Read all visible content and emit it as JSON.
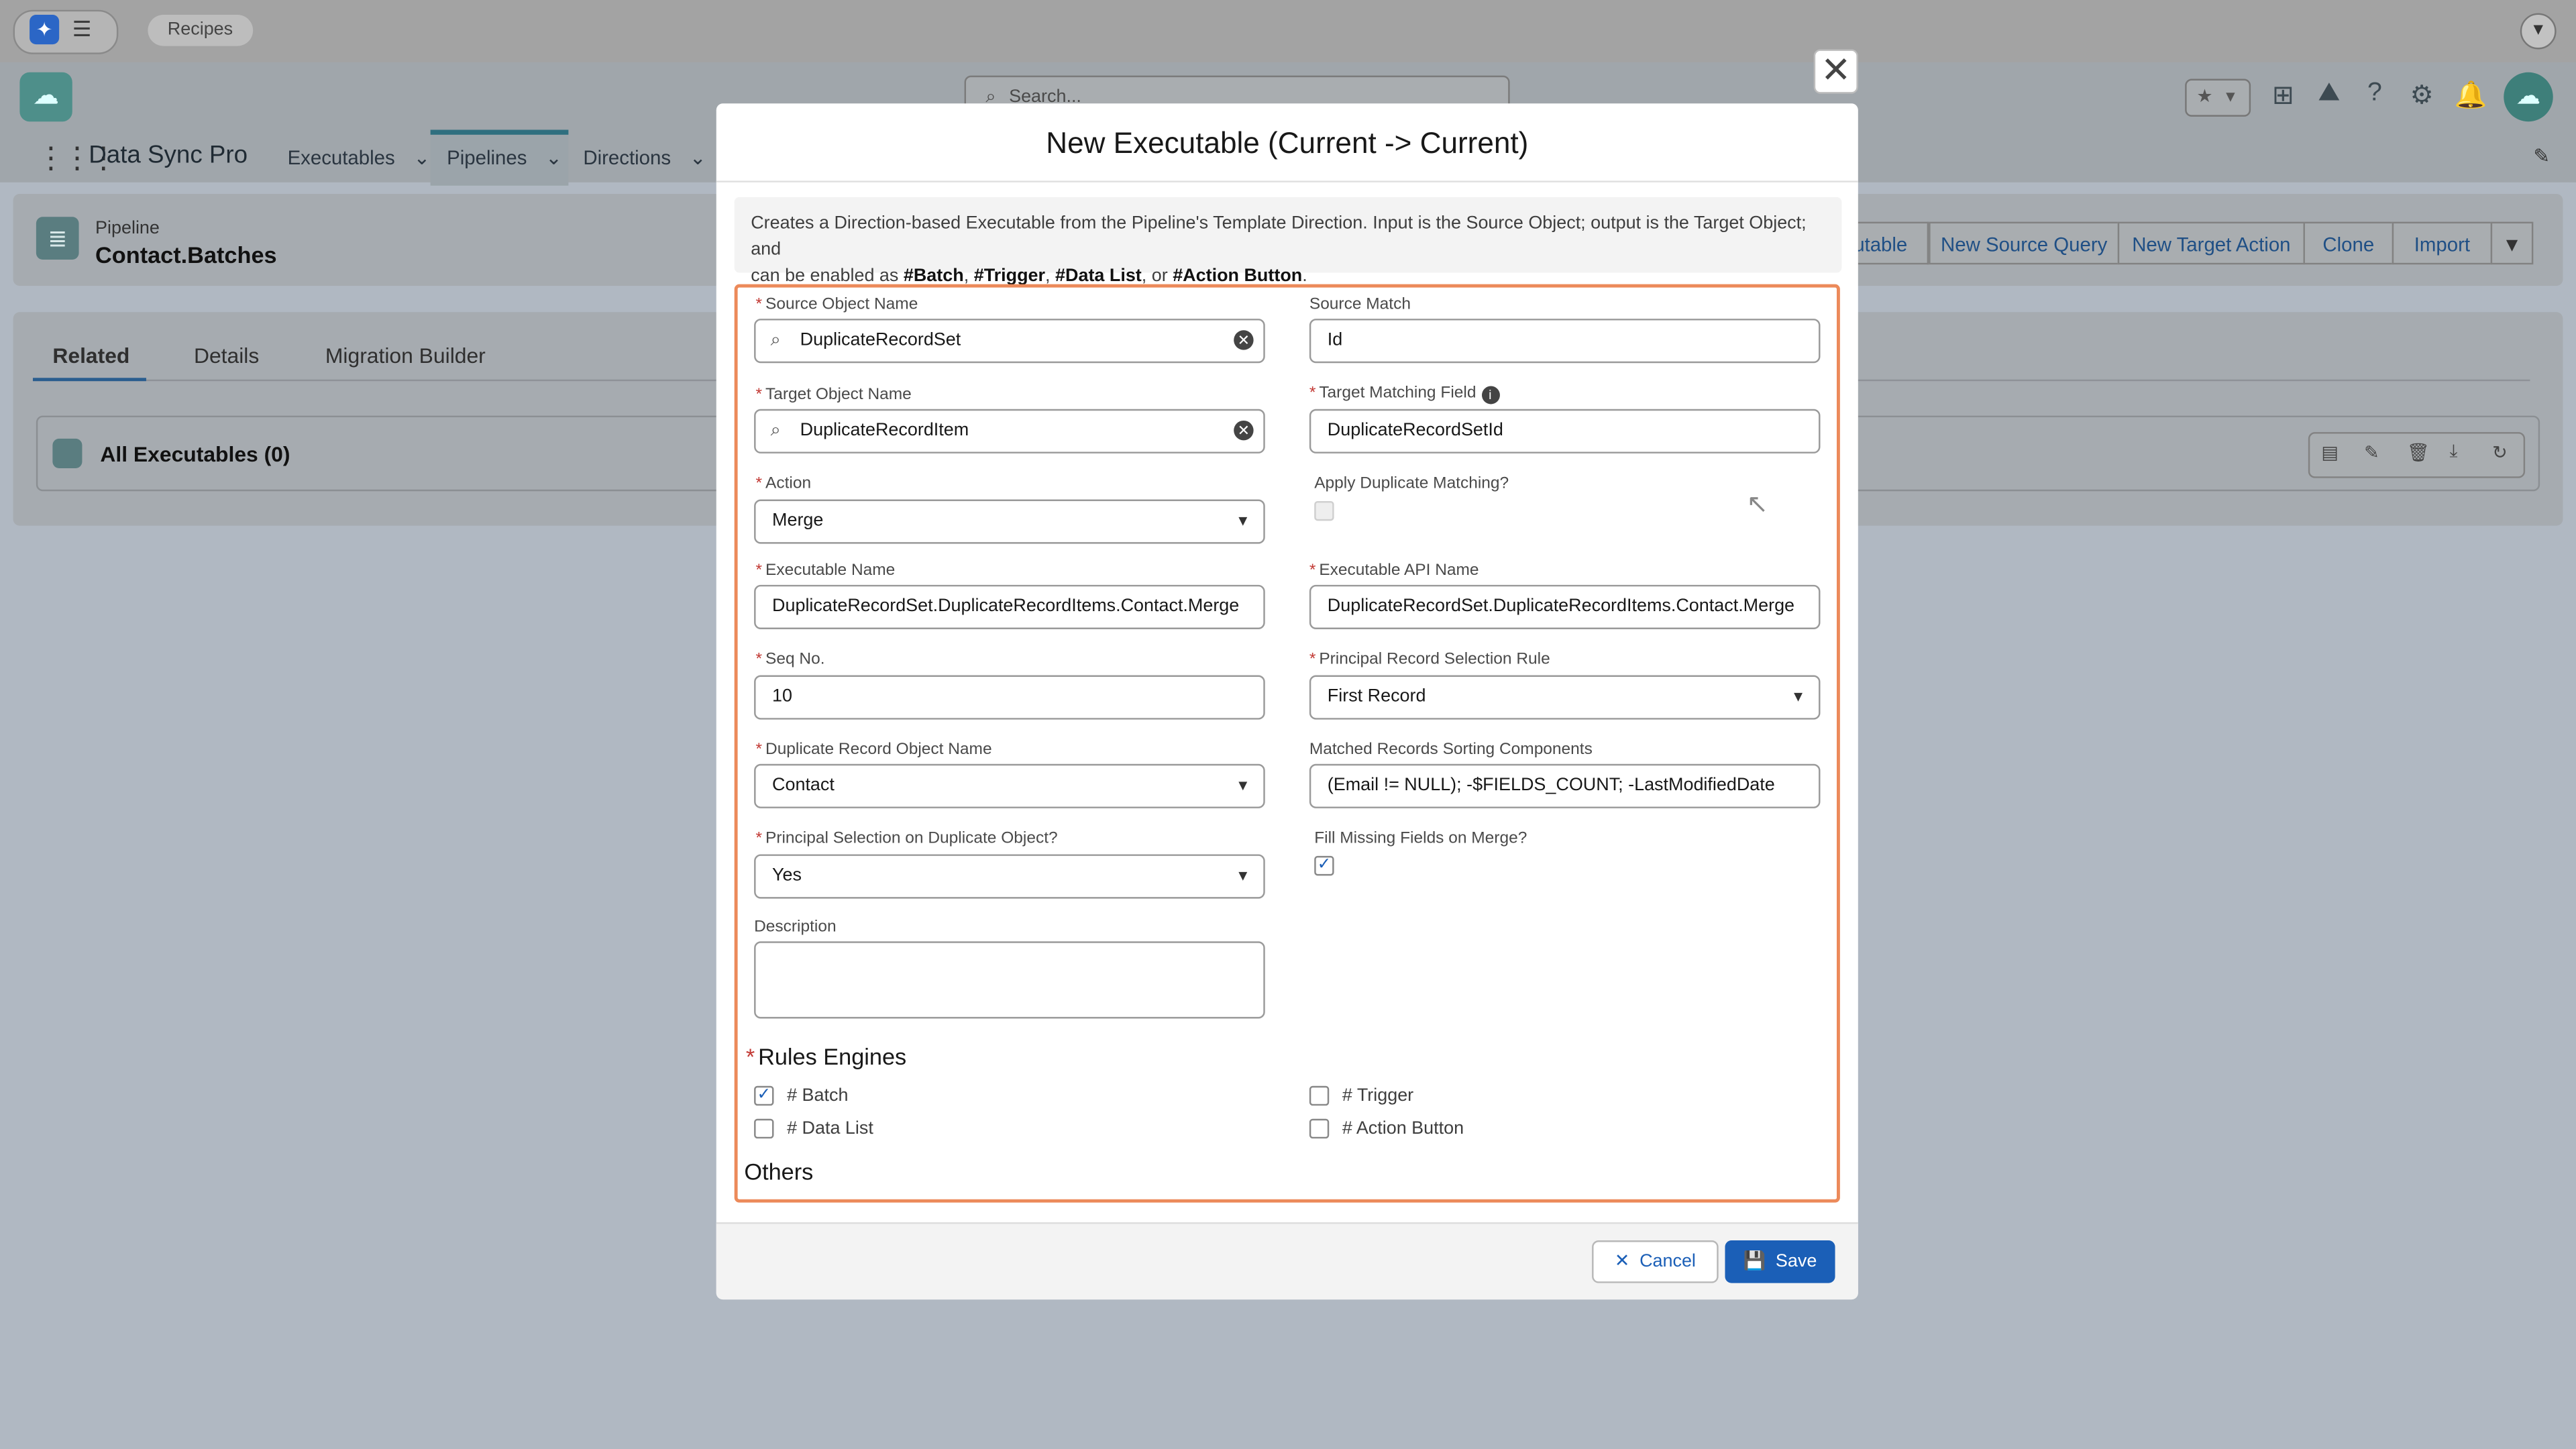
{
  "browser": {
    "tab_label": "Recipes"
  },
  "header": {
    "search_placeholder": "Search..."
  },
  "nav": {
    "app_name": "Data Sync Pro",
    "items": [
      {
        "label": "Executables"
      },
      {
        "label": "Pipelines"
      },
      {
        "label": "Directions"
      }
    ]
  },
  "record": {
    "object_label": "Pipeline",
    "title": "Contact.Batches",
    "actions": [
      "utable",
      "New Source Query",
      "New Target Action",
      "Clone",
      "Import"
    ]
  },
  "tabs": [
    "Related",
    "Details",
    "Migration Builder"
  ],
  "related": {
    "title": "All Executables (0)"
  },
  "modal": {
    "title": "New Executable (Current -> Current)",
    "intro_1": "Creates a Direction-based Executable from the Pipeline's Template Direction. Input is the Source Object; output is the Target Object; and",
    "intro_2a": "can be enabled as ",
    "tag_batch": "#Batch",
    "tag_trigger": "#Trigger",
    "tag_datalist": "#Data List",
    "intro_or": ", or ",
    "tag_action": "#Action Button",
    "intro_end": ".",
    "fields": {
      "source_object_name": {
        "label": "Source Object Name",
        "value": "DuplicateRecordSet"
      },
      "source_match": {
        "label": "Source Match",
        "value": "Id"
      },
      "target_object_name": {
        "label": "Target Object Name",
        "value": "DuplicateRecordItem"
      },
      "target_matching_field": {
        "label": "Target Matching Field",
        "value": "DuplicateRecordSetId"
      },
      "action": {
        "label": "Action",
        "value": "Merge"
      },
      "apply_duplicate_matching": {
        "label": "Apply Duplicate Matching?",
        "checked": false
      },
      "executable_name": {
        "label": "Executable Name",
        "value": "DuplicateRecordSet.DuplicateRecordItems.Contact.Merge"
      },
      "executable_api_name": {
        "label": "Executable API Name",
        "value": "DuplicateRecordSet.DuplicateRecordItems.Contact.Merge"
      },
      "seq_no": {
        "label": "Seq No.",
        "value": "10"
      },
      "principal_rule": {
        "label": "Principal Record Selection Rule",
        "value": "First Record"
      },
      "duplicate_object": {
        "label": "Duplicate Record Object Name",
        "value": "Contact"
      },
      "sorting_components": {
        "label": "Matched Records Sorting Components",
        "value": "(Email != NULL); -$FIELDS_COUNT; -LastModifiedDate"
      },
      "principal_on_duplicate": {
        "label": "Principal Selection on Duplicate Object?",
        "value": "Yes"
      },
      "fill_missing": {
        "label": "Fill Missing Fields on Merge?",
        "checked": true
      },
      "description": {
        "label": "Description",
        "value": ""
      }
    },
    "rules_engines": {
      "heading": "Rules Engines",
      "batch": {
        "label": "# Batch",
        "checked": true
      },
      "trigger": {
        "label": "# Trigger",
        "checked": false
      },
      "data_list": {
        "label": "# Data List",
        "checked": false
      },
      "action_button": {
        "label": "# Action Button",
        "checked": false
      }
    },
    "others_heading": "Others",
    "cancel_label": "Cancel",
    "save_label": "Save"
  },
  "colors": {
    "brand_blue": "#1b5fb7",
    "focus_orange": "#ec8a5a",
    "required_red": "#c23934"
  }
}
